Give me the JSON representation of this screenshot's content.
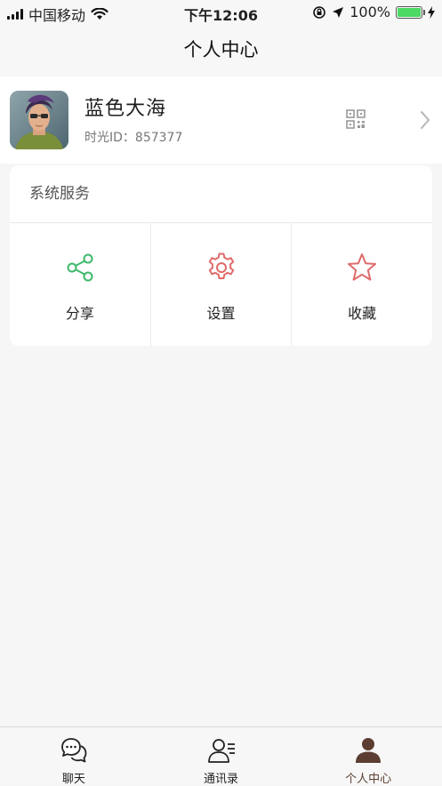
{
  "status_bar": {
    "carrier": "中国移动",
    "time": "下午12:06",
    "battery": "100%"
  },
  "nav": {
    "title": "个人中心"
  },
  "profile": {
    "name": "蓝色大海",
    "id_text": "时光ID：857377"
  },
  "services": {
    "title": "系统服务",
    "items": [
      {
        "label": "分享",
        "icon": "share-icon"
      },
      {
        "label": "设置",
        "icon": "gear-icon"
      },
      {
        "label": "收藏",
        "icon": "star-icon"
      }
    ]
  },
  "tabs": [
    {
      "label": "聊天",
      "icon": "chat-icon"
    },
    {
      "label": "通讯录",
      "icon": "contacts-icon"
    },
    {
      "label": "个人中心",
      "icon": "person-icon",
      "active": true
    }
  ],
  "colors": {
    "share": "#3db86b",
    "settings": "#e06a6a",
    "star": "#e06a6a",
    "active_tab": "#5b3e31"
  }
}
